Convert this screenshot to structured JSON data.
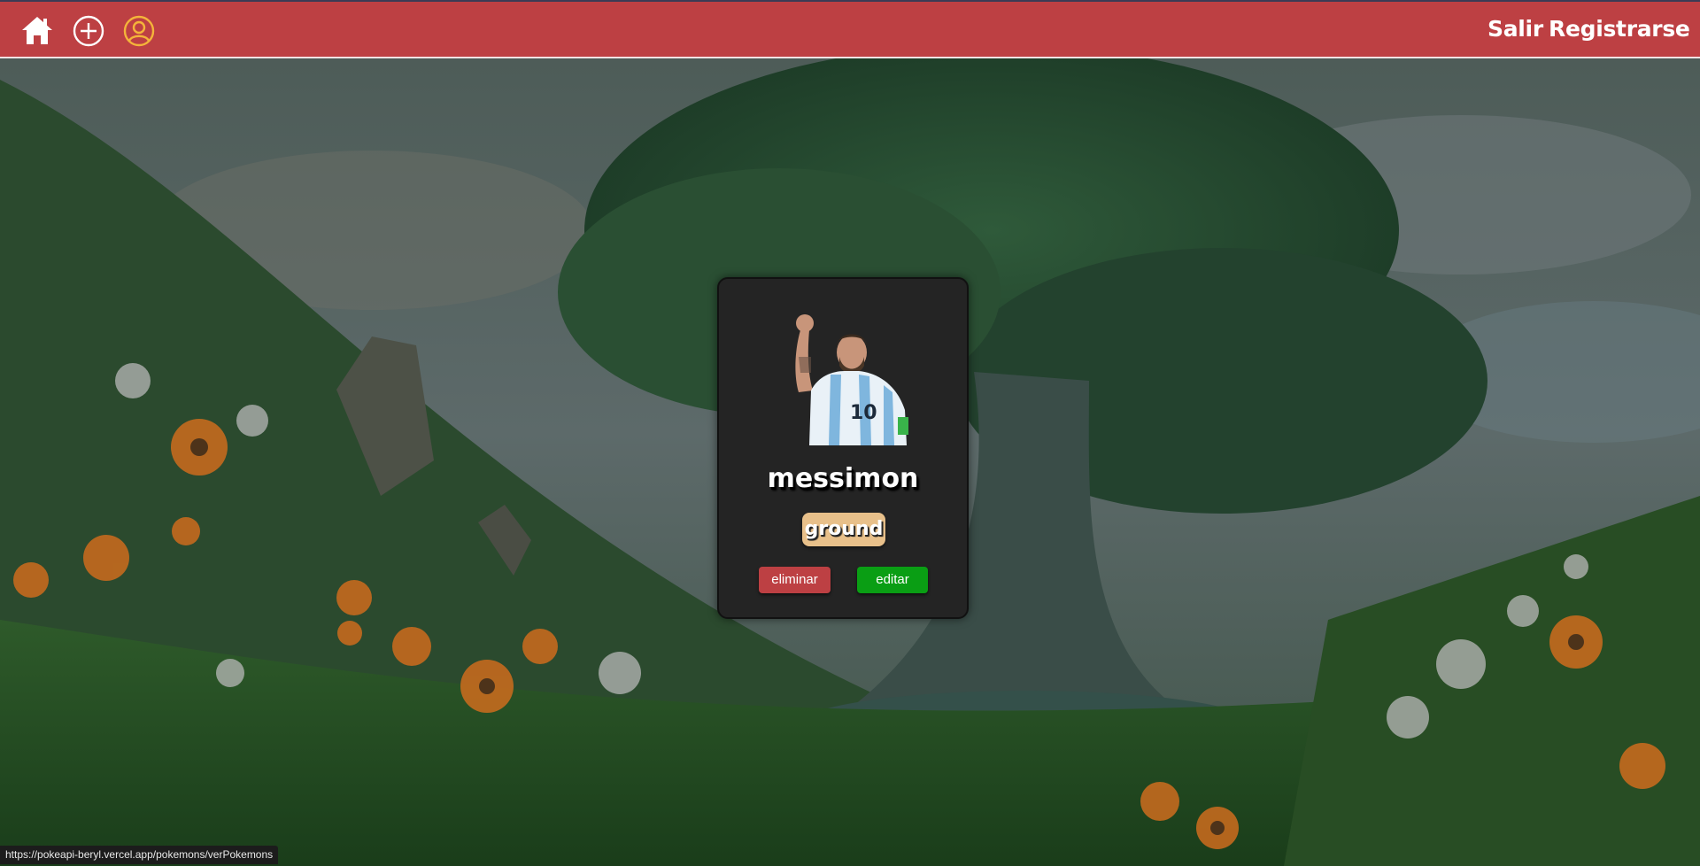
{
  "navbar": {
    "icons": [
      "home-icon",
      "plus-circle-icon",
      "user-circle-icon"
    ],
    "links": {
      "logout": "Salir",
      "register": "Registrarse"
    },
    "colors": {
      "background": "#bd4043",
      "text": "#ffffff",
      "user_icon": "#f4b43a"
    }
  },
  "card": {
    "name": "messimon",
    "type": "ground",
    "image_icon": "player-portrait",
    "buttons": {
      "delete": "eliminar",
      "edit": "editar"
    },
    "colors": {
      "background": "#242424",
      "type_badge": "#e8c08a",
      "delete": "#bd4043",
      "edit": "#0a9e14"
    }
  },
  "status_bar": {
    "url": "https://pokeapi-beryl.vercel.app/pokemons/verPokemons"
  }
}
